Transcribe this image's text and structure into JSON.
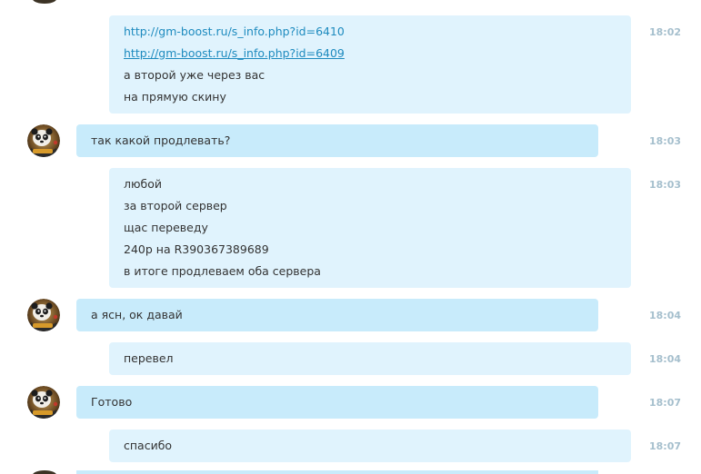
{
  "messages": [
    {
      "direction": "out",
      "time": "18:02",
      "lines": [
        {
          "text": "http://gm-boost.ru/s_info.php?id=6410",
          "link": true,
          "underline": false
        },
        {
          "text": "http://gm-boost.ru/s_info.php?id=6409",
          "link": true,
          "underline": true
        },
        {
          "text": "а второй уже через вас",
          "link": false
        },
        {
          "text": "на прямую скину",
          "link": false
        }
      ]
    },
    {
      "direction": "in",
      "time": "18:03",
      "lines": [
        {
          "text": "так какой продлевать?",
          "link": false
        }
      ]
    },
    {
      "direction": "out",
      "time": "18:03",
      "lines": [
        {
          "text": "любой",
          "link": false
        },
        {
          "text": "за второй сервер",
          "link": false
        },
        {
          "text": "щас переведу",
          "link": false
        },
        {
          "text": "240р на R390367389689",
          "link": false
        },
        {
          "text": "в итоге продлеваем оба сервера",
          "link": false
        }
      ]
    },
    {
      "direction": "in",
      "time": "18:04",
      "lines": [
        {
          "text": "а ясн, ок давай",
          "link": false
        }
      ]
    },
    {
      "direction": "out",
      "time": "18:04",
      "lines": [
        {
          "text": "перевел",
          "link": false
        }
      ]
    },
    {
      "direction": "in",
      "time": "18:07",
      "lines": [
        {
          "text": "Готово",
          "link": false
        }
      ]
    },
    {
      "direction": "out",
      "time": "18:07",
      "lines": [
        {
          "text": "спасибо",
          "link": false
        }
      ]
    }
  ],
  "avatar": {
    "icon": "panda-avatar-icon"
  }
}
